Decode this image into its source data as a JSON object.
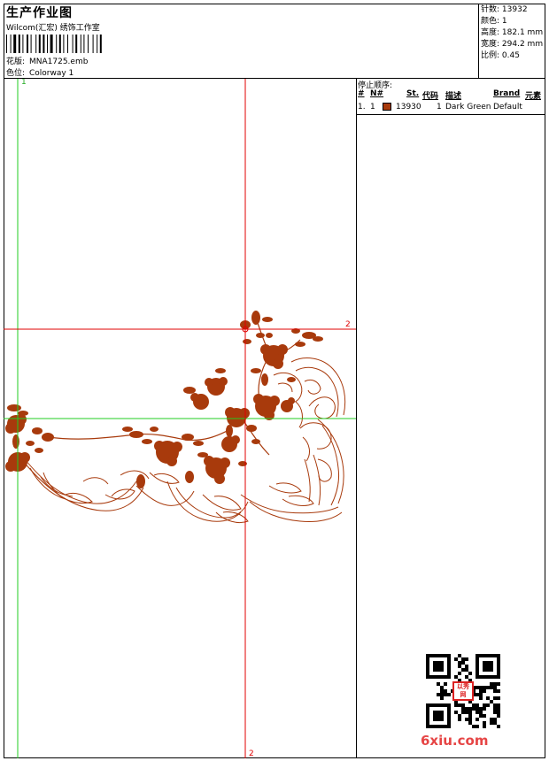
{
  "header": {
    "title": "生产作业图",
    "studio": "Wilcom(汇宏) 绣饰工作室",
    "design_label": "花版:",
    "design_value": "MNA1725.emb",
    "colorway_label": "色位:",
    "colorway_value": "Colorway 1"
  },
  "stats": [
    {
      "label": "针数:",
      "value": "13932"
    },
    {
      "label": "颜色:",
      "value": "1"
    },
    {
      "label": "高度:",
      "value": "182.1 mm"
    },
    {
      "label": "宽度:",
      "value": "294.2 mm"
    },
    {
      "label": "比例:",
      "value": "0.45"
    }
  ],
  "stop_sequence": {
    "title": "停止顺序:",
    "columns": [
      "#",
      "N#",
      "St.",
      "代码",
      "描述",
      "Brand",
      "元素"
    ],
    "rows": [
      {
        "index": "1.",
        "n": "1",
        "stitches": "13930",
        "code": "1",
        "description": "Dark Green",
        "brand": "Default",
        "color": "#a83a0c"
      }
    ]
  },
  "guides": {
    "green_top": "1",
    "red_right": "2",
    "red_bottom": "2"
  },
  "watermark": {
    "site": "6xiu.com",
    "stamp": "以秀网"
  },
  "colors": {
    "thread": "#a83a0c",
    "guide_red": "#e00000",
    "guide_green": "#22cc22"
  }
}
